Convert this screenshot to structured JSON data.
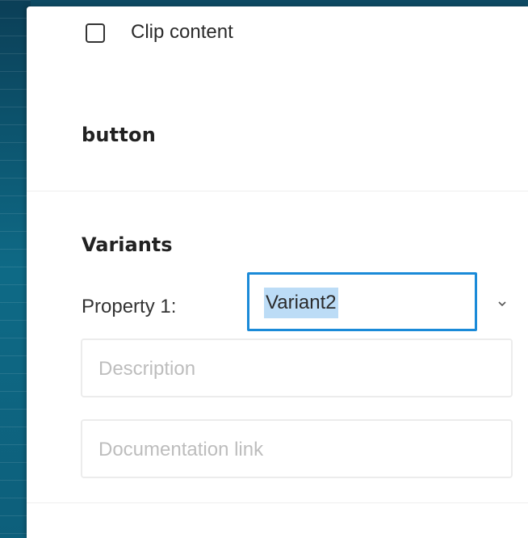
{
  "clip": {
    "label": "Clip content",
    "checked": false
  },
  "layer": {
    "name": "button"
  },
  "variants": {
    "title": "Variants",
    "property_label": "Property 1:",
    "property_value": "Variant2",
    "description_placeholder": "Description",
    "doc_link_placeholder": "Documentation link"
  },
  "icons": {
    "checkbox": "checkbox-icon",
    "chevron": "chevron-down-icon"
  },
  "colors": {
    "focus_border": "#1a8ad8",
    "selection": "#bcdcf6"
  }
}
